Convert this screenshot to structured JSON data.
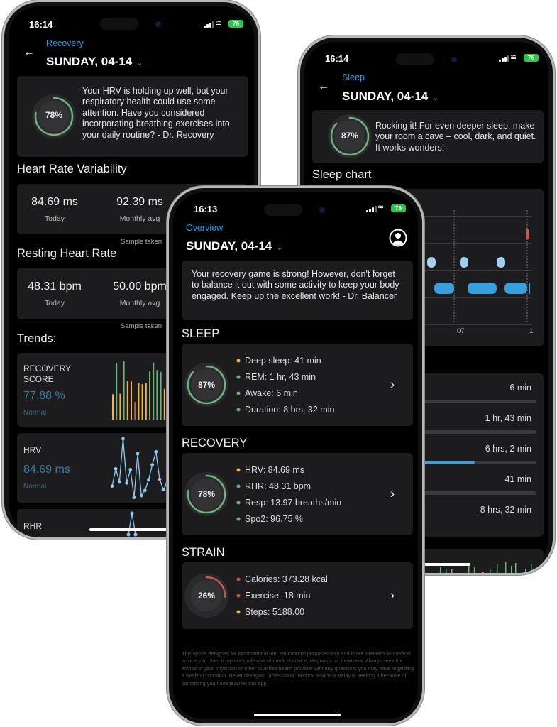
{
  "colors": {
    "accent": "#2f9ad8",
    "green": "#6db37a",
    "yellow": "#f2b835",
    "red": "#c9574a",
    "card": "#1c1c1e",
    "battery": "#31c24a"
  },
  "recovery_screen": {
    "status": {
      "time": "16:14",
      "battery": "76"
    },
    "breadcrumb": "Recovery",
    "back_icon": "arrow-left-icon",
    "date": "SUNDAY, 04-14",
    "score": {
      "percent": 78,
      "label": "78%"
    },
    "message": "Your HRV is holding up well, but your respiratory health could use some attention. Have you considered incorporating breathing exercises into your daily routine? - Dr. Recovery",
    "hrv": {
      "title": "Heart Rate Variability",
      "today": "84.69 ms",
      "today_label": "Today",
      "monthly": "92.39 ms",
      "monthly_label": "Monthly avg",
      "sample": "Sample taken"
    },
    "rhr": {
      "title": "Resting Heart Rate",
      "today": "48.31 bpm",
      "today_label": "Today",
      "monthly": "50.00 bpm",
      "monthly_label": "Monthly avg",
      "sample": "Sample taken"
    },
    "trends": {
      "title": "Trends:",
      "recovery": {
        "label": "RECOVERY SCORE",
        "value": "77.88 %",
        "status": "Normal"
      },
      "hrv": {
        "label": "HRV",
        "value": "84.69 ms",
        "status": "Normal"
      },
      "rhr": {
        "label": "RHR"
      }
    }
  },
  "sleep_screen": {
    "status": {
      "time": "16:14",
      "battery": "76"
    },
    "breadcrumb": "Sleep",
    "date": "SUNDAY, 04-14",
    "score": {
      "percent": 87,
      "label": "87%"
    },
    "message": "Rocking it! For even deeper sleep, make your room a cave – cool, dark, and quiet. It works wonders!",
    "chart_title": "Sleep chart",
    "chart_ticks": [
      "07",
      "1"
    ],
    "stages": [
      {
        "value": "6 min",
        "fraction": 0.012
      },
      {
        "value": "1 hr, 43 min",
        "fraction": 0.2
      },
      {
        "value": "6 hrs, 2 min",
        "fraction": 0.707
      },
      {
        "value": "41 min",
        "fraction": 0.08
      },
      {
        "value": "8 hrs, 32 min"
      }
    ]
  },
  "overview_screen": {
    "status": {
      "time": "16:13",
      "battery": "76"
    },
    "breadcrumb": "Overview",
    "date": "SUNDAY, 04-14",
    "profile_icon": "user-circle-icon",
    "message": "Your recovery game is strong! However, don't forget to balance it out with some activity to keep your body engaged. Keep up the excellent work! - Dr. Balancer",
    "sections": [
      {
        "title": "SLEEP",
        "percent": 87,
        "label": "87%",
        "ring_color": "#6db37a",
        "items": [
          {
            "text": "Deep sleep: 41 min",
            "color": "#f2b835"
          },
          {
            "text": "REM: 1 hr, 43 min",
            "color": "#6db37a"
          },
          {
            "text": "Awake: 6 min",
            "color": "#6db37a"
          },
          {
            "text": "Duration: 8 hrs, 32 min",
            "color": "#6db37a"
          }
        ]
      },
      {
        "title": "RECOVERY",
        "percent": 78,
        "label": "78%",
        "ring_color": "#6db37a",
        "items": [
          {
            "text": "HRV: 84.69 ms",
            "color": "#f2b835"
          },
          {
            "text": "RHR: 48.31 bpm",
            "color": "#6db37a"
          },
          {
            "text": "Resp: 13.97 breaths/min",
            "color": "#6db37a"
          },
          {
            "text": "Spo2: 96.75 %",
            "color": "#6db37a"
          }
        ]
      },
      {
        "title": "STRAIN",
        "percent": 26,
        "label": "26%",
        "ring_color": "#c9574a",
        "items": [
          {
            "text": "Calories: 373.28 kcal",
            "color": "#c9574a"
          },
          {
            "text": "Exercise: 18 min",
            "color": "#c9574a"
          },
          {
            "text": "Steps: 5188.00",
            "color": "#f2b835"
          }
        ]
      }
    ],
    "disclaimer": "This app is designed for informational and educational purposes only and is not intended as medical advice, nor does it replace professional medical advice, diagnosis, or treatment. Always seek the advice of your physician or other qualified health provider with any questions you may have regarding a medical condition. Never disregard professional medical advice or delay in seeking it because of something you have read on this app."
  },
  "chart_data": [
    {
      "type": "bar",
      "title": "RECOVERY SCORE",
      "values": [
        43,
        96,
        44,
        99,
        66,
        65,
        30,
        62,
        60,
        62,
        82,
        97,
        84,
        81,
        52,
        62
      ],
      "colors": [
        "#f2b835",
        "#6db37a",
        "#f2b835",
        "#6db37a",
        "#f2b835",
        "#f2b835",
        "#c9574a",
        "#f2b835",
        "#f2b835",
        "#f2b835",
        "#6db37a",
        "#6db37a",
        "#6db37a",
        "#6db37a",
        "#f2b835",
        "#f2b835"
      ],
      "ylim": [
        0,
        100
      ]
    },
    {
      "type": "line",
      "title": "HRV",
      "values": [
        69.7,
        84.4,
        73.1,
        110,
        72.3,
        83.8,
        60,
        97.3,
        61.6,
        66,
        75.1,
        87.8,
        98.9,
        75.5,
        66.7,
        71.7
      ],
      "color": "#8ccbf0"
    }
  ]
}
